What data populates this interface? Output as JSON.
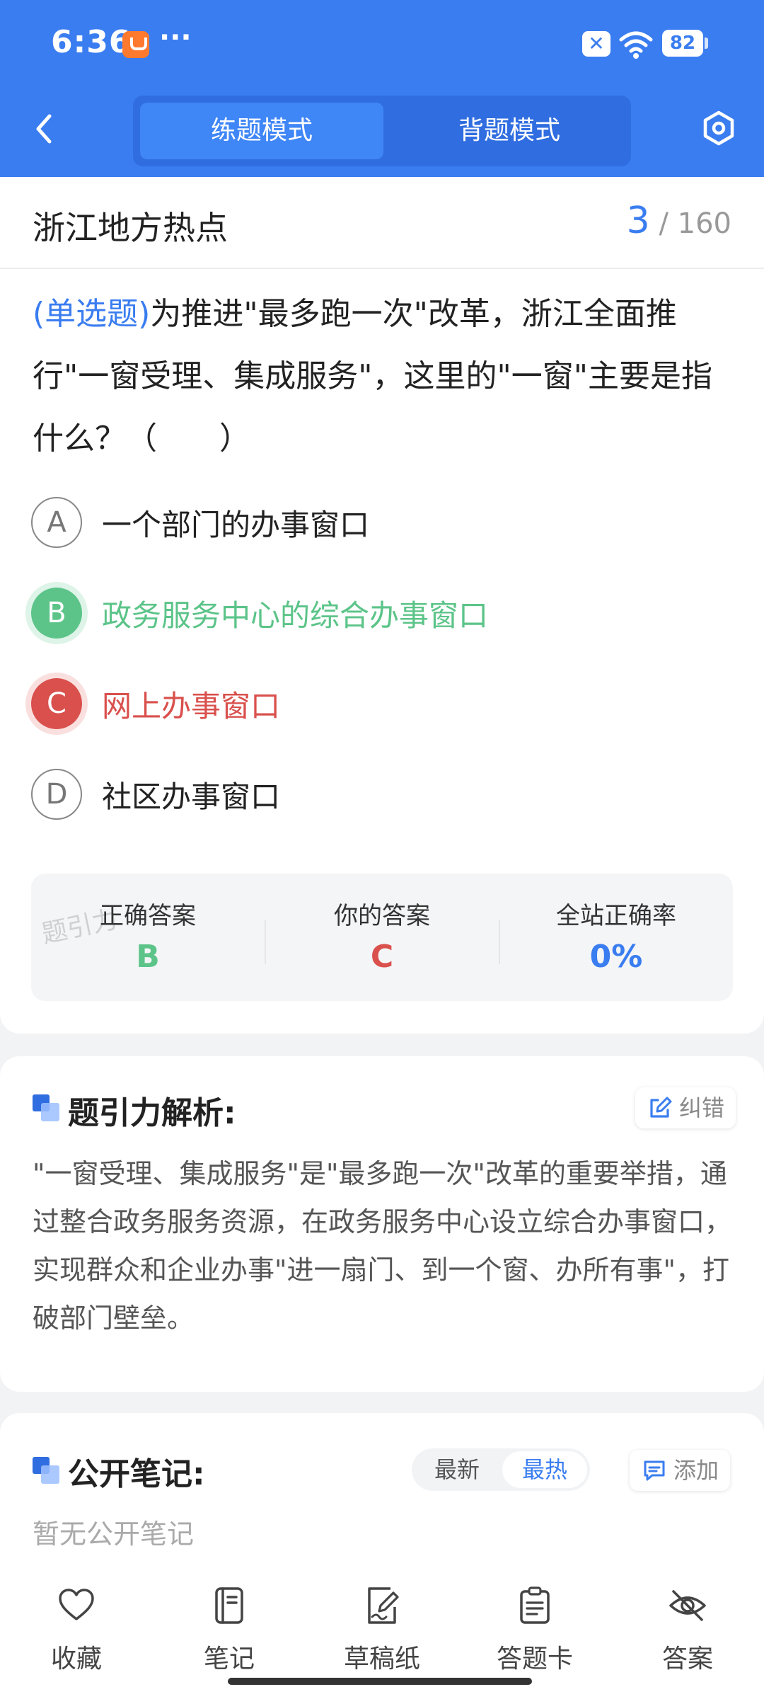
{
  "status_bar": {
    "time": "6:36",
    "dots": "···",
    "battery": "82",
    "sim": "✕"
  },
  "header": {
    "modes": [
      {
        "label": "练题模式",
        "active": true
      },
      {
        "label": "背题模式",
        "active": false
      }
    ]
  },
  "category": {
    "title": "浙江地方热点",
    "current": "3",
    "total": "160"
  },
  "question": {
    "type_label": "(单选题)",
    "text": "为推进\"最多跑一次\"改革，浙江全面推行\"一窗受理、集成服务\"，这里的\"一窗\"主要是指什么？（　　）"
  },
  "options": [
    {
      "letter": "A",
      "text": "一个部门的办事窗口",
      "state": "normal"
    },
    {
      "letter": "B",
      "text": "政务服务中心的综合办事窗口",
      "state": "correct"
    },
    {
      "letter": "C",
      "text": "网上办事窗口",
      "state": "wrong"
    },
    {
      "letter": "D",
      "text": "社区办事窗口",
      "state": "normal"
    }
  ],
  "answer_summary": {
    "watermark": "题引力",
    "correct_label": "正确答案",
    "correct_value": "B",
    "yours_label": "你的答案",
    "yours_value": "C",
    "rate_label": "全站正确率",
    "rate_value": "0%"
  },
  "analysis": {
    "title": "题引力解析:",
    "report_label": "纠错",
    "text": "\"一窗受理、集成服务\"是\"最多跑一次\"改革的重要举措，通过整合政务服务资源，在政务服务中心设立综合办事窗口，实现群众和企业办事\"进一扇门、到一个窗、办所有事\"，打破部门壁垒。"
  },
  "notes": {
    "title": "公开笔记:",
    "sort_latest": "最新",
    "sort_hot": "最热",
    "add_label": "添加",
    "empty_text": "暂无公开笔记"
  },
  "bottom_bar": {
    "items": [
      {
        "label": "收藏",
        "icon": "heart-icon"
      },
      {
        "label": "笔记",
        "icon": "notebook-icon"
      },
      {
        "label": "草稿纸",
        "icon": "draft-paper-icon"
      },
      {
        "label": "答题卡",
        "icon": "answer-card-icon"
      },
      {
        "label": "答案",
        "icon": "eye-off-icon"
      }
    ]
  },
  "colors": {
    "primary": "#3a7df0",
    "correct": "#5cc489",
    "wrong": "#d9504c"
  }
}
